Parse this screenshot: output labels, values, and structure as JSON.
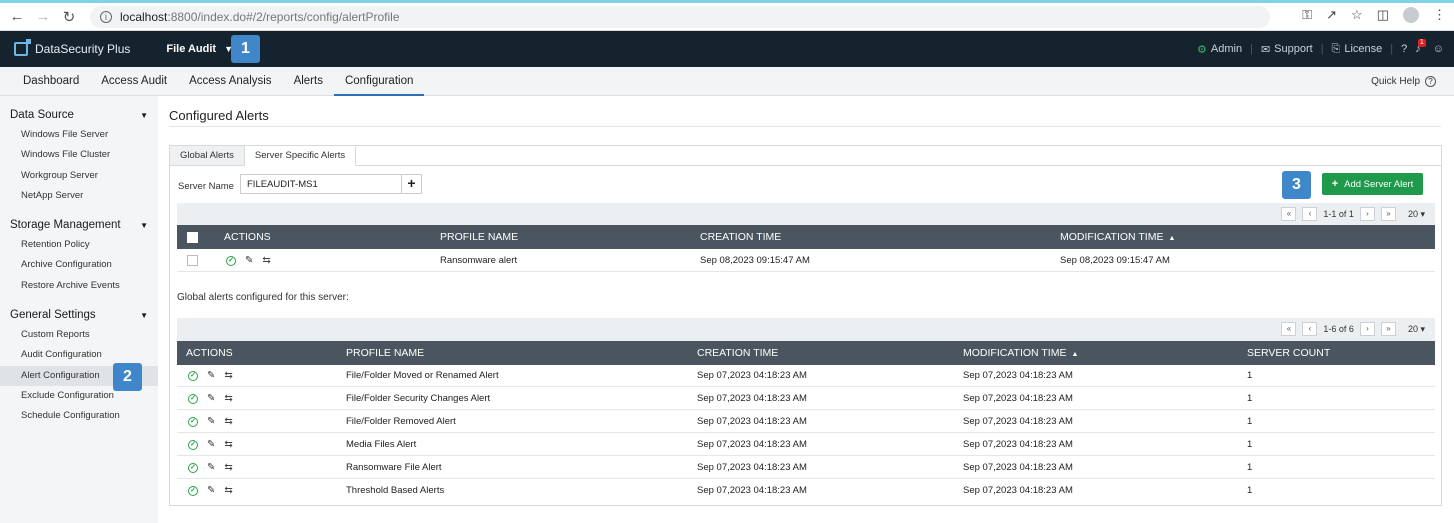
{
  "browser": {
    "url_host": "localhost",
    "url_path": ":8800/index.do#/2/reports/config/alertProfile"
  },
  "header": {
    "logo_text": "DataSecurity Plus",
    "product": "File Audit",
    "admin": "Admin",
    "support": "Support",
    "license": "License",
    "notifications": "1"
  },
  "steps": {
    "one": "1",
    "two": "2",
    "three": "3"
  },
  "tabs": [
    {
      "label": "Dashboard"
    },
    {
      "label": "Access Audit"
    },
    {
      "label": "Access Analysis"
    },
    {
      "label": "Alerts"
    },
    {
      "label": "Configuration"
    }
  ],
  "quick_help": "Quick Help",
  "sidebar": {
    "sections": [
      {
        "title": "Data Source",
        "items": [
          "Windows File Server",
          "Windows File Cluster",
          "Workgroup Server",
          "NetApp Server"
        ]
      },
      {
        "title": "Storage Management",
        "items": [
          "Retention Policy",
          "Archive Configuration",
          "Restore Archive Events"
        ]
      },
      {
        "title": "General Settings",
        "items": [
          "Custom Reports",
          "Audit Configuration",
          "Alert Configuration",
          "Exclude Configuration",
          "Schedule Configuration"
        ]
      }
    ]
  },
  "page_title": "Configured Alerts",
  "sub_tabs": [
    "Global Alerts",
    "Server Specific Alerts"
  ],
  "server": {
    "label": "Server Name",
    "value": "FILEAUDIT-MS1",
    "add": "+"
  },
  "add_server_alert": "Add Server Alert",
  "server_table": {
    "pager": {
      "range": "1-1 of 1",
      "size": "20"
    },
    "headers": [
      "ACTIONS",
      "PROFILE NAME",
      "CREATION TIME",
      "MODIFICATION TIME"
    ],
    "rows": [
      {
        "profile": "Ransomware alert",
        "created": "Sep 08,2023 09:15:47 AM",
        "modified": "Sep 08,2023 09:15:47 AM"
      }
    ]
  },
  "global_note": "Global alerts configured for this server:",
  "global_table": {
    "pager": {
      "range": "1-6 of 6",
      "size": "20"
    },
    "headers": [
      "ACTIONS",
      "PROFILE NAME",
      "CREATION TIME",
      "MODIFICATION TIME",
      "SERVER COUNT"
    ],
    "rows": [
      {
        "profile": "File/Folder Moved or Renamed Alert",
        "created": "Sep 07,2023 04:18:23 AM",
        "modified": "Sep 07,2023 04:18:23 AM",
        "count": "1"
      },
      {
        "profile": "File/Folder Security Changes Alert",
        "created": "Sep 07,2023 04:18:23 AM",
        "modified": "Sep 07,2023 04:18:23 AM",
        "count": "1"
      },
      {
        "profile": "File/Folder Removed Alert",
        "created": "Sep 07,2023 04:18:23 AM",
        "modified": "Sep 07,2023 04:18:23 AM",
        "count": "1"
      },
      {
        "profile": "Media Files Alert",
        "created": "Sep 07,2023 04:18:23 AM",
        "modified": "Sep 07,2023 04:18:23 AM",
        "count": "1"
      },
      {
        "profile": "Ransomware File Alert",
        "created": "Sep 07,2023 04:18:23 AM",
        "modified": "Sep 07,2023 04:18:23 AM",
        "count": "1"
      },
      {
        "profile": "Threshold Based Alerts",
        "created": "Sep 07,2023 04:18:23 AM",
        "modified": "Sep 07,2023 04:18:23 AM",
        "count": "1"
      }
    ]
  }
}
